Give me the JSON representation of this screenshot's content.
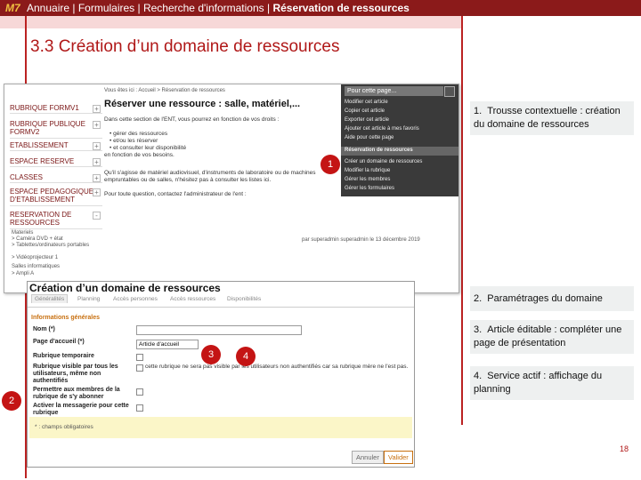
{
  "header": {
    "logo": "M7",
    "nav_plain": "Annuaire | Formulaires | Recherche d'informations | ",
    "nav_bold": "Réservation de ressources"
  },
  "section_title": "3.3  Création d’un domaine de ressources",
  "screenshot1": {
    "breadcrumb": "Vous êtes ici : Accueil > Réservation de ressources",
    "sidebar": [
      {
        "label": "RUBRIQUE FORMV1",
        "sign": "+"
      },
      {
        "label": "RUBRIQUE PUBLIQUE FORMV2",
        "sign": "+"
      },
      {
        "label": "ETABLISSEMENT",
        "sign": "+"
      },
      {
        "label": "ESPACE RESERVE",
        "sign": "+"
      },
      {
        "label": "CLASSES",
        "sign": "+"
      },
      {
        "label": "ESPACE PEDAGOGIQUE D'ETABLISSEMENT",
        "sign": "+"
      },
      {
        "label": "RESERVATION DE RESSOURCES",
        "sign": "-"
      }
    ],
    "sidebar_sub": [
      "Materiels",
      "> Caméra DVD + état",
      "> Tablettes/ordinateurs portables",
      "> Vidéoprojecteur 1",
      "Salles informatiques",
      "> Ampli A"
    ],
    "title": "Réserver une ressource : salle, matériel,...",
    "intro": "Dans cette section de l'ENT, vous pourrez en fonction de vos droits :",
    "bullets": [
      "gérer des ressources",
      "et/ou les réserver",
      "et consulter leur disponibilité"
    ],
    "after_bullets": "en fonction de vos besoins.",
    "para2a": "Qu'il s'agisse de matériel audiovisuel, d'instruments de laboratoire ou de machines",
    "para2b": "empruntables ou de salles, n'hésitez pas à consulter les listes ici.",
    "para3": "Pour toute question, contactez l'administrateur de l'ent :",
    "byline": "par superadmin superadmin le 13 décembre 2019",
    "menu_title": "Pour cette page...",
    "menu_items": [
      "Modifier cet article",
      "Copier cet article",
      "Exporter cet article",
      "Ajouter cet article à mes favoris",
      "Aide pour cette page",
      "Réservation de ressources",
      "Créer un domaine de ressources",
      "Modifier la rubrique",
      "Gérer les membres",
      "Gérer les formulaires"
    ]
  },
  "screenshot2": {
    "title": "Création d’un domaine de ressources",
    "tabs": [
      "Généralités",
      "Planning",
      "Accès personnes",
      "Accès ressources",
      "Disponibilités"
    ],
    "section": "Informations générales",
    "fields": [
      {
        "label": "Nom (*)"
      },
      {
        "label": "Page d'accueil (*)",
        "value": "Article d'accueil"
      },
      {
        "label": "Rubrique temporaire"
      },
      {
        "label": "Rubrique visible par tous les utilisateurs, même non authentifiés",
        "note": "cette rubrique ne sera pas visible par les utilisateurs non authentifiés car sa rubrique mère ne l'est pas."
      },
      {
        "label": "Permettre aux membres de la rubrique de s'y abonner"
      },
      {
        "label": "Activer la messagerie pour cette rubrique"
      }
    ],
    "required_note": "* : champs obligatoires",
    "cancel": "Annuler",
    "validate": "Valider"
  },
  "callouts": [
    {
      "num": "1",
      "text": "Trousse contextuelle : création du domaine de ressources"
    },
    {
      "num": "2",
      "text": "Paramétrages du domaine"
    },
    {
      "num": "3",
      "text": "Article éditable : compléter une page de présentation"
    },
    {
      "num": "4",
      "text": "Service actif : affichage du planning"
    }
  ],
  "badges": [
    "1",
    "2",
    "3",
    "4"
  ],
  "page_number": "18",
  "colors": {
    "brand": "#8b1a1a",
    "accent": "#c41414",
    "logo": "#f0c040"
  }
}
